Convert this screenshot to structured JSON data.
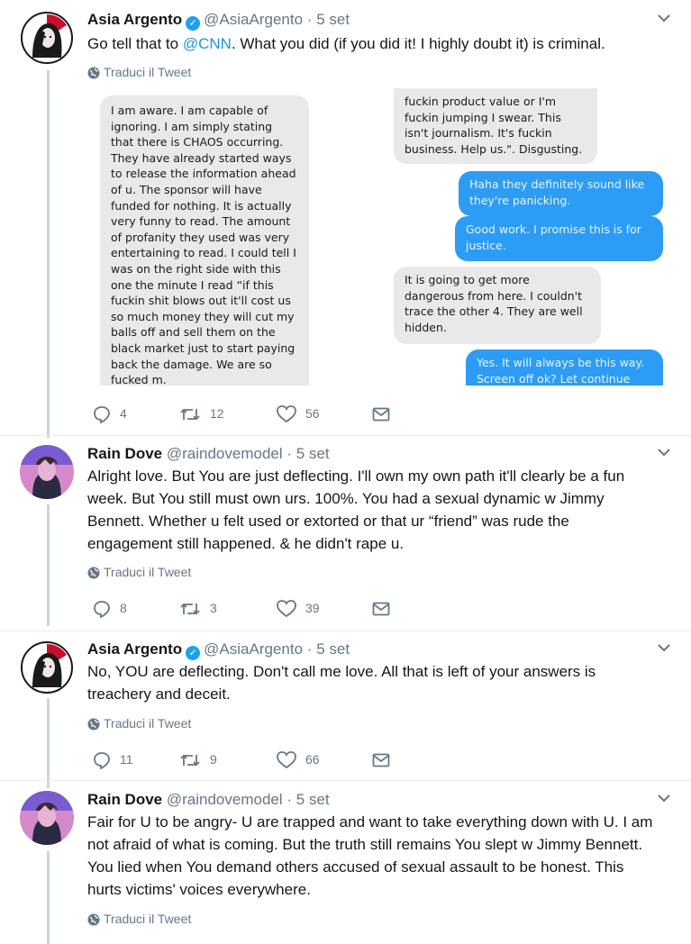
{
  "tweets": [
    {
      "author": "Asia Argento",
      "handle": "@AsiaArgento",
      "time": "5 set",
      "verified": true,
      "text_before": "Go tell that to ",
      "mention": "@CNN",
      "text_after": ". What you did (if you did it! I highly doubt it) is criminal.",
      "translate": "Traduci il Tweet",
      "replies": "4",
      "retweets": "12",
      "likes": "56",
      "image": {
        "left_bubble": "I am aware. I am capable of ignoring. I am simply stating that there is CHAOS occurring. They have already started ways to release the information ahead of u. The sponsor will have funded for nothing. It is actually very funny to read. The amount of profanity they used was very entertaining to read. I could tell I was on the right side with this one the minute I read “if this fuckin shit blows out it'll cost us so much money they will cut my balls off and sell them on the black market just to start paying back the damage. We are so fucked m.",
        "right_top": "fuckin product value or I'm fuckin jumping I swear. This isn't journalism. It's fuckin business. Help us.\". Disgusting.",
        "blue_1": "Haha they definitely sound like they're panicking.",
        "blue_2": "Good work. I promise this is for justice.",
        "gray_2": "It is going to get more dangerous from here. I couldn't trace the other 4. They are well hidden.",
        "blue_3": "Yes. It will always be this way. Screen off ok? Let continue"
      }
    },
    {
      "author": "Rain Dove",
      "handle": "@raindovemodel",
      "time": "5 set",
      "verified": false,
      "text": "Alright love. But You are just deflecting. I'll own my own path it'll clearly be a fun week. But You still must own urs. 100%. You had a sexual dynamic w Jimmy Bennett. Whether u felt used or extorted or that ur “friend” was rude the engagement still happened. & he didn't rape u.",
      "translate": "Traduci il Tweet",
      "replies": "8",
      "retweets": "3",
      "likes": "39"
    },
    {
      "author": "Asia Argento",
      "handle": "@AsiaArgento",
      "time": "5 set",
      "verified": true,
      "text": "No, YOU are deflecting. Don't call me love. All that is left of your answers is treachery and deceit.",
      "translate": "Traduci il Tweet",
      "replies": "11",
      "retweets": "9",
      "likes": "66"
    },
    {
      "author": "Rain Dove",
      "handle": "@raindovemodel",
      "time": "5 set",
      "verified": false,
      "text": "Fair for U to be angry- U are trapped and want to take everything down with U. I am not afraid of what is coming. But the truth still remains You slept w Jimmy Bennett. You lied when You demand others accused of sexual assault to be honest. This hurts victims' voices everywhere.",
      "translate": "Traduci il Tweet"
    }
  ],
  "separator_dot": "·",
  "colors": {
    "accent": "#1da1f2",
    "muted": "#657786",
    "thread": "#c8d6e0"
  }
}
